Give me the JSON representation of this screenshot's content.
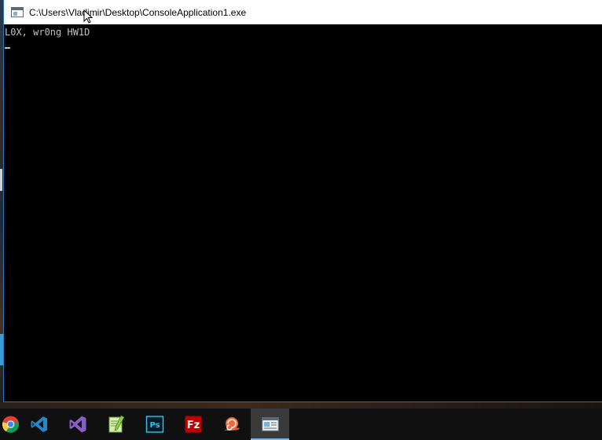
{
  "window": {
    "title": "C:\\Users\\Vladimir\\Desktop\\ConsoleApplication1.exe",
    "icon": "console-app-icon"
  },
  "console": {
    "lines": [
      "L0X, wr0ng HW1D"
    ],
    "text_color": "#c0c0c0",
    "background": "#000000"
  },
  "taskbar": {
    "items": [
      {
        "name": "chrome",
        "icon": "chrome-icon"
      },
      {
        "name": "visual-studio-code",
        "icon": "vscode-icon"
      },
      {
        "name": "visual-studio",
        "icon": "visual-studio-icon"
      },
      {
        "name": "notepad-plus-plus",
        "icon": "notepad-plus-plus-icon"
      },
      {
        "name": "photoshop",
        "icon": "photoshop-icon"
      },
      {
        "name": "filezilla",
        "icon": "filezilla-icon"
      },
      {
        "name": "snail-app",
        "icon": "snail-icon"
      },
      {
        "name": "console-application",
        "icon": "console-window-icon",
        "active": true
      }
    ],
    "accent": "#1979ca"
  }
}
